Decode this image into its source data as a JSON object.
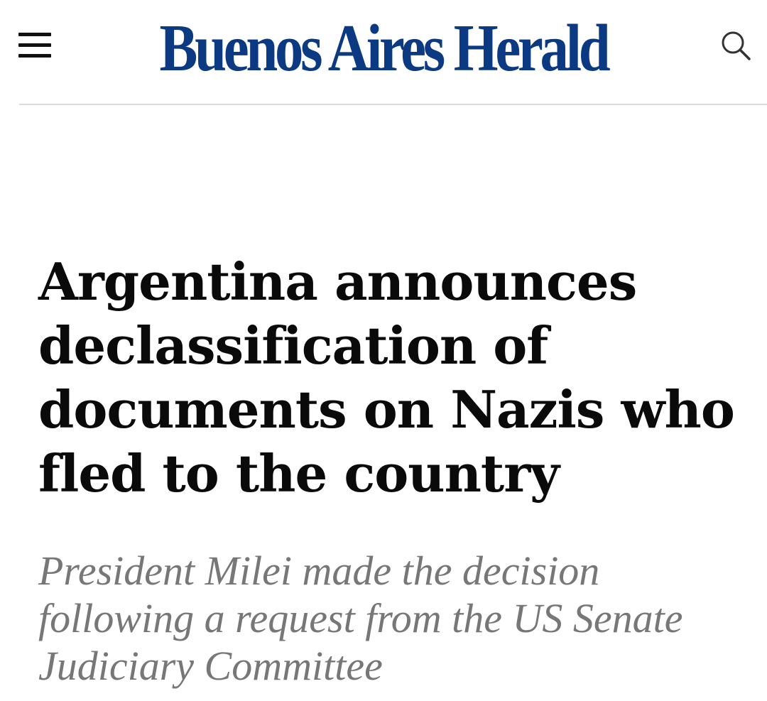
{
  "header": {
    "logo_text": "Buenos Aires Herald",
    "menu_icon": "hamburger-menu-icon",
    "search_icon": "search-icon",
    "brand_color": "#0b3a82"
  },
  "article": {
    "headline": "Argentina announces declassification of documents on Nazis who fled to the country",
    "subheadline": "President Milei made the decision following a request from the US Senate Judiciary Committee",
    "headline_color": "#0a0a0a",
    "subheadline_color": "#777777"
  }
}
